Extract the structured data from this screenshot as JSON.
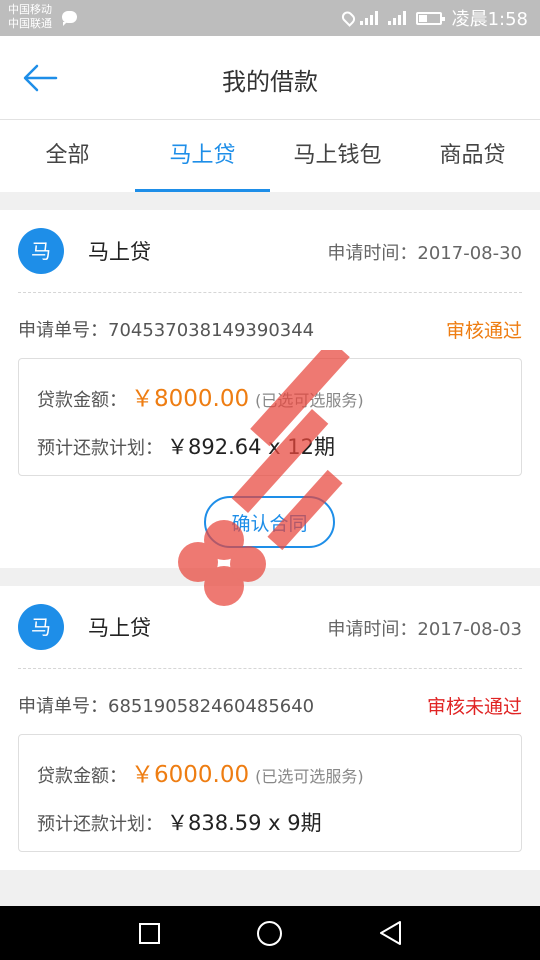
{
  "status_bar": {
    "carrier_1": "中国移动",
    "carrier_2": "中国联通",
    "time": "凌晨1:58"
  },
  "header": {
    "title": "我的借款",
    "back_icon": "arrow-left-icon"
  },
  "tabs": [
    {
      "label": "全部",
      "active": false
    },
    {
      "label": "马上贷",
      "active": true
    },
    {
      "label": "马上钱包",
      "active": false
    },
    {
      "label": "商品贷",
      "active": false
    }
  ],
  "loans": [
    {
      "avatar": "马",
      "product": "马上贷",
      "apply_time": "申请时间：2017-08-30",
      "order_no": "申请单号：704537038149390344",
      "status": "审核通过",
      "amount_label": "贷款金额：",
      "amount": "￥8000.00",
      "amount_note": "(已选可选服务)",
      "plan_label": "预计还款计划：",
      "plan": "￥892.64 x 12期",
      "action": "确认合同"
    },
    {
      "avatar": "马",
      "product": "马上贷",
      "apply_time": "申请时间：2017-08-03",
      "order_no": "申请单号：685190582460485640",
      "status": "审核未通过",
      "amount_label": "贷款金额：",
      "amount": "￥6000.00",
      "amount_note": "(已选可选服务)",
      "plan_label": "预计还款计划：",
      "plan": "￥838.59 x 9期"
    }
  ],
  "colors": {
    "accent": "#1e8ee8",
    "approved": "#ee7d12",
    "rejected": "#e02424",
    "watermark": "#e8463c"
  },
  "icons": {
    "nav_recent": "square-icon",
    "nav_home": "circle-icon",
    "nav_back": "triangle-back-icon"
  }
}
